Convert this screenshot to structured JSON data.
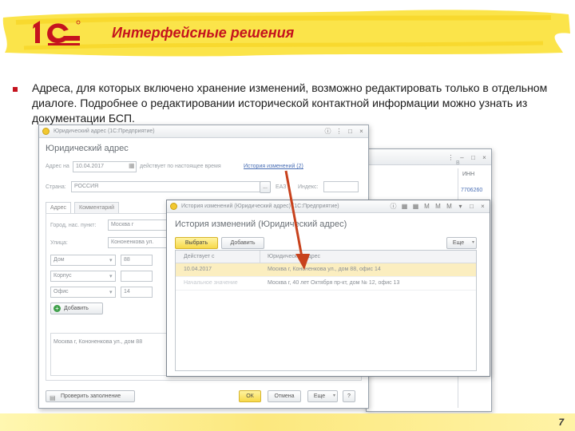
{
  "header": {
    "title": "Интерфейсные решения",
    "logo_text": "1С"
  },
  "bullet": {
    "text": "Адреса, для которых включено хранение изменений, возможно редактировать только в отдельном диалоге. Подробнее о редактировании исторической контактной информации можно узнать из документации БСП."
  },
  "page_number": "7",
  "back_window": {
    "inn_label": "ИНН",
    "inn_value": "7706260",
    "label_b": "B"
  },
  "address_window": {
    "title_bar": "Юридический адрес (1С:Предприятие)",
    "heading": "Юридический адрес",
    "address_on_label": "Адрес на",
    "date_value": "10.04.2017",
    "valid_text": "действует по настоящее время",
    "history_link": "История изменений (2)",
    "country_label": "Страна:",
    "country_value": "РОССИЯ",
    "tabs": [
      "Адрес",
      "Комментарий"
    ],
    "city_label": "Город, нас. пункт:",
    "city_value": "Москва г",
    "street_label": "Улица:",
    "street_value": "Кононенкова ул.",
    "house_type": "Дом",
    "house_value": "88",
    "building_type": "Корпус",
    "building_value": "",
    "office_type": "Офис",
    "office_value": "14",
    "add_button": "Добавить",
    "address_summary": "Москва г, Кононенкова ул., дом 88",
    "check_button": "Проверить заполнение",
    "ok_button": "ОК",
    "cancel_button": "Отмена",
    "more_button": "Еще",
    "help_button": "?",
    "region_label": "ЕАЗ",
    "code_label": "Индекс:"
  },
  "history_window": {
    "title_bar": "История изменений (Юридический адрес) (1С:Предприятие)",
    "heading": "История изменений (Юридический адрес)",
    "select_button": "Выбрать",
    "add_button": "Добавить",
    "more_button": "Еще",
    "columns": [
      "Действует с",
      "Юридический адрес"
    ],
    "rows": [
      {
        "date": "10.04.2017",
        "address": "Москва г, Кононенкова ул., дом 88, офис 14"
      },
      {
        "date": "Начальное значение",
        "address": "Москва г, 40 лет Октября пр-кт, дом № 12, офис 13"
      }
    ]
  },
  "colors": {
    "accent_red": "#c5131e",
    "highlight_yellow": "#fbeec0",
    "arrow": "#c8421d"
  }
}
